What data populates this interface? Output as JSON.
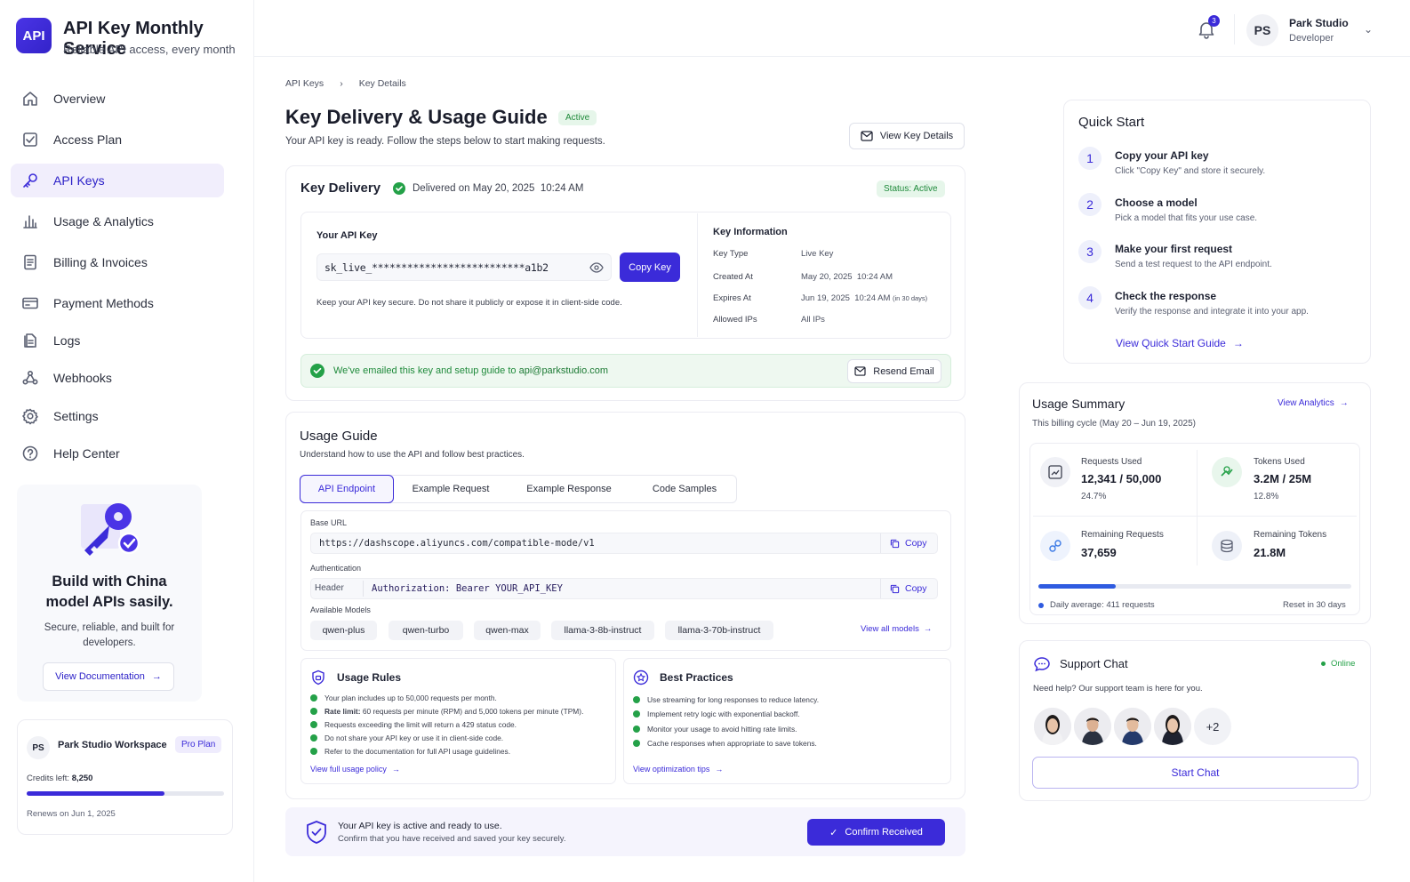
{
  "app": {
    "logo": "API",
    "title": "API Key Monthly Service",
    "subtitle": "Reliable API access, every month"
  },
  "user": {
    "initials": "PS",
    "name": "Park Studio",
    "role": "Developer",
    "notifications": "3"
  },
  "sidebar": {
    "items": [
      {
        "label": "Overview",
        "icon": "home-icon"
      },
      {
        "label": "Access Plan",
        "icon": "plan-icon"
      },
      {
        "label": "API Keys",
        "icon": "key-icon",
        "active": true
      },
      {
        "label": "Usage & Analytics",
        "icon": "bar-chart-icon"
      },
      {
        "label": "Billing & Invoices",
        "icon": "invoice-icon"
      },
      {
        "label": "Payment Methods",
        "icon": "card-icon"
      },
      {
        "label": "Logs",
        "icon": "logs-icon"
      },
      {
        "label": "Webhooks",
        "icon": "webhook-icon"
      },
      {
        "label": "Settings",
        "icon": "gear-icon"
      },
      {
        "label": "Help Center",
        "icon": "help-icon"
      }
    ],
    "promo": {
      "title": "Build with China model APIs sasily.",
      "text": "Secure, reliable, and built for developers.",
      "button": "View Documentation"
    },
    "workspace": {
      "initials": "PS",
      "name": "Park Studio Workspace",
      "plan": "Pro Plan",
      "credits_label": "Credits left:",
      "credits": "8,250",
      "credits_fraction": 0.7,
      "renews": "Renews on Jun 1, 2025"
    }
  },
  "breadcrumb": {
    "parent": "API Keys",
    "current": "Key Details"
  },
  "page": {
    "title": "Key Delivery & Usage Guide",
    "status": "Active",
    "subtitle": "Your API key is ready. Follow the steps below to start making requests.",
    "view_details_btn": "View Key Details"
  },
  "delivery": {
    "title": "Key Delivery",
    "delivered": "Delivered on May 20, 2025  10:24 AM",
    "status": "Status: Active",
    "key_label": "Your API Key",
    "key_value": "sk_live_**************************a1b2",
    "copy_btn": "Copy Key",
    "warning": "Keep your API key secure. Do not share it publicly or expose it in client-side code.",
    "info_title": "Key Information",
    "info": [
      {
        "k": "Key Type",
        "v": "Live Key",
        "note": ""
      },
      {
        "k": "Created At",
        "v": "May 20, 2025  10:24 AM",
        "note": ""
      },
      {
        "k": "Expires At",
        "v": "Jun 19, 2025  10:24 AM",
        "note": "(in 30 days)"
      },
      {
        "k": "Allowed IPs",
        "v": "All IPs",
        "note": ""
      }
    ],
    "email_msg": "We've emailed this key and setup guide to",
    "email": "api@parkstudio.com",
    "resend_btn": "Resend Email"
  },
  "guide": {
    "title": "Usage Guide",
    "subtitle": "Understand how to use the API and follow best practices.",
    "tabs": [
      "API Endpoint",
      "Example Request",
      "Example Response",
      "Code Samples"
    ],
    "base_url_label": "Base URL",
    "base_url": "https://dashscope.aliyuncs.com/compatible-mode/v1",
    "copy": "Copy",
    "auth_label": "Authentication",
    "auth_header": "Header",
    "auth_value": "Authorization: Bearer YOUR_API_KEY",
    "models_label": "Available Models",
    "models": [
      "qwen-plus",
      "qwen-turbo",
      "qwen-max",
      "llama-3-8b-instruct",
      "llama-3-70b-instruct"
    ],
    "view_models": "View all models",
    "rules": {
      "title": "Usage Rules",
      "link": "View full usage policy",
      "items": [
        {
          "b": "",
          "t": "Your plan includes up to 50,000 requests per month."
        },
        {
          "b": "Rate limit:",
          "t": " 60 requests per minute (RPM) and 5,000 tokens per minute (TPM)."
        },
        {
          "b": "",
          "t": "Requests exceeding the limit will return a 429 status code."
        },
        {
          "b": "",
          "t": "Do not share your API key or use it in client-side code."
        },
        {
          "b": "",
          "t": "Refer to the documentation for full API usage guidelines."
        }
      ]
    },
    "practices": {
      "title": "Best Practices",
      "link": "View optimization tips",
      "items": [
        "Use streaming for long responses to reduce latency.",
        "Implement retry logic with exponential backoff.",
        "Monitor your usage to avoid hitting rate limits.",
        "Cache responses when appropriate to save tokens."
      ]
    }
  },
  "confirm": {
    "title": "Your API key is active and ready to use.",
    "text": "Confirm that you have received and saved your key securely.",
    "button": "Confirm Received"
  },
  "quickstart": {
    "title": "Quick Start",
    "link": "View Quick Start Guide",
    "steps": [
      {
        "n": "1",
        "t": "Copy your API key",
        "d": "Click \"Copy Key\" and store it securely."
      },
      {
        "n": "2",
        "t": "Choose a model",
        "d": "Pick a model that fits your use case."
      },
      {
        "n": "3",
        "t": "Make your first request",
        "d": "Send a test request to the API endpoint."
      },
      {
        "n": "4",
        "t": "Check the response",
        "d": "Verify the response and integrate it into your app."
      }
    ]
  },
  "usage": {
    "title": "Usage Summary",
    "link": "View Analytics",
    "cycle": "This billing cycle (May 20 – Jun 19, 2025)",
    "requests": {
      "label": "Requests Used",
      "value": "12,341 / 50,000",
      "pct": "24.7%"
    },
    "tokens": {
      "label": "Tokens Used",
      "value": "3.2M / 25M",
      "pct": "12.8%"
    },
    "rem_requests": {
      "label": "Remaining Requests",
      "value": "37,659"
    },
    "rem_tokens": {
      "label": "Remaining Tokens",
      "value": "21.8M"
    },
    "progress": 0.247,
    "daily": "Daily average: 411 requests",
    "reset": "Reset in 30 days"
  },
  "support": {
    "title": "Support Chat",
    "status": "Online",
    "text": "Need help? Our support team is here for you.",
    "more": "+2",
    "button": "Start Chat"
  }
}
